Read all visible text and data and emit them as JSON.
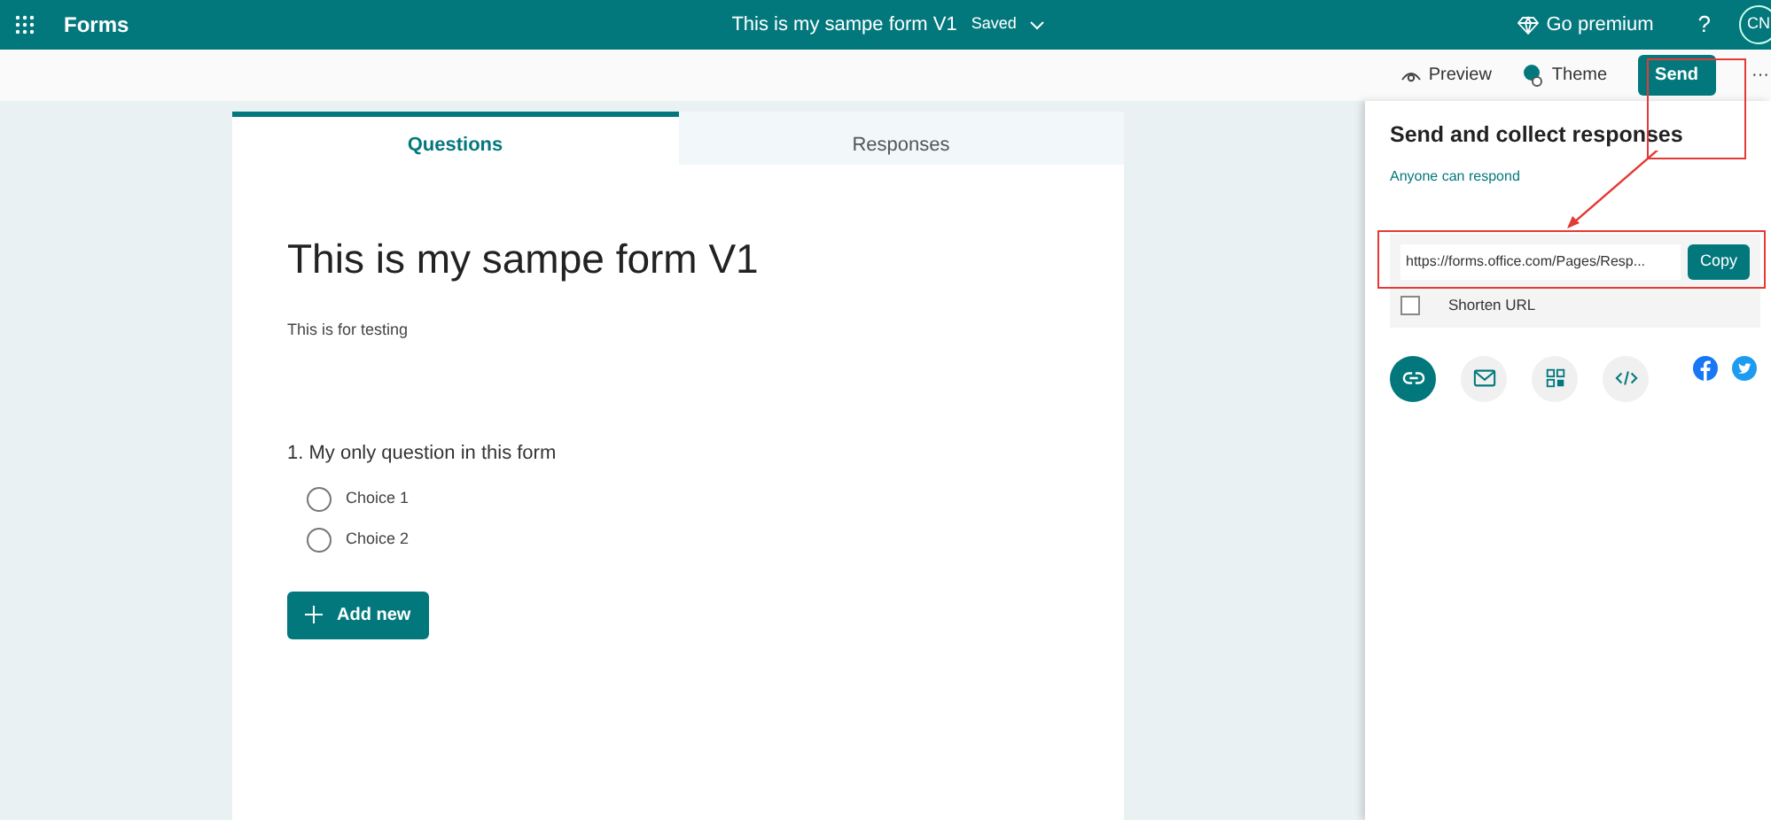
{
  "app": {
    "name": "Forms",
    "form_title": "This is my sampe form V1",
    "save_state": "Saved",
    "premium": "Go premium",
    "help": "?",
    "avatar": "CN"
  },
  "toolbar": {
    "preview": "Preview",
    "theme": "Theme",
    "send": "Send",
    "more": "···"
  },
  "tabs": [
    {
      "label": "Questions",
      "selected": true
    },
    {
      "label": "Responses",
      "selected": false
    }
  ],
  "form": {
    "title": "This is my sampe form V1",
    "description": "This is for testing",
    "questions": [
      {
        "label": "1. My only question in this form",
        "choices": [
          {
            "label": "Choice 1",
            "selected": false
          },
          {
            "label": "Choice 2",
            "selected": false
          }
        ]
      }
    ],
    "add_button": "Add new"
  },
  "send_panel": {
    "title": "Send and collect responses",
    "audience": "Anyone can respond",
    "url": "https://forms.office.com/Pages/Resp...",
    "copy": "Copy",
    "shorten": {
      "label": "Shorten URL",
      "checked": false
    },
    "share_options": [
      {
        "kind": "link",
        "selected": true
      },
      {
        "kind": "email",
        "selected": false
      },
      {
        "kind": "qr",
        "selected": false
      },
      {
        "kind": "embed",
        "selected": false
      }
    ]
  }
}
